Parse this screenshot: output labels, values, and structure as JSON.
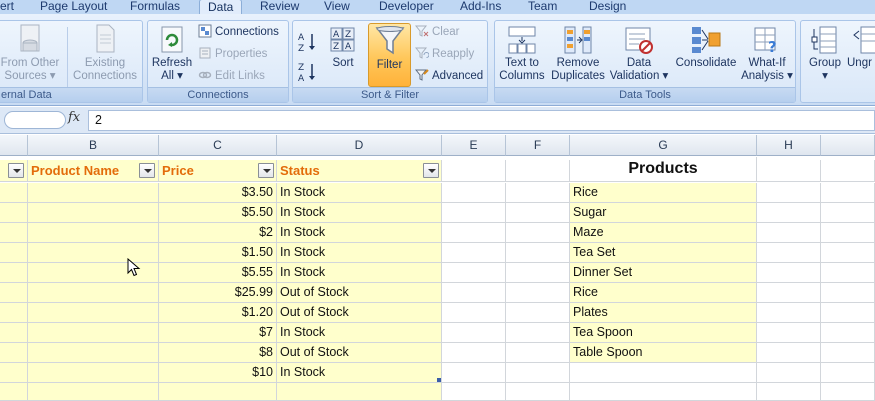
{
  "tabs": [
    "ert",
    "Page Layout",
    "Formulas",
    "Data",
    "Review",
    "View",
    "Developer",
    "Add-Ins",
    "Team",
    "Design"
  ],
  "active_tab": "Data",
  "ribbon": {
    "get_external": {
      "from_other_l1": "From Other",
      "from_other_l2": "Sources",
      "existing_l1": "Existing",
      "existing_l2": "Connections",
      "label": "ernal Data"
    },
    "connections": {
      "refresh_l1": "Refresh",
      "refresh_l2": "All",
      "connections": "Connections",
      "properties": "Properties",
      "edit_links": "Edit Links",
      "label": "Connections"
    },
    "sort_filter": {
      "sort": "Sort",
      "filter": "Filter",
      "clear": "Clear",
      "reapply": "Reapply",
      "advanced": "Advanced",
      "label": "Sort & Filter"
    },
    "data_tools": {
      "text_to_l1": "Text to",
      "text_to_l2": "Columns",
      "remove_l1": "Remove",
      "remove_l2": "Duplicates",
      "validation_l1": "Data",
      "validation_l2": "Validation",
      "consolidate": "Consolidate",
      "whatif_l1": "What-If",
      "whatif_l2": "Analysis",
      "label": "Data Tools"
    },
    "outline": {
      "group": "Group",
      "ungroup": "Ungr"
    }
  },
  "formula_bar": {
    "fx": "fx",
    "value": "2"
  },
  "columns": [
    "B",
    "C",
    "D",
    "E",
    "F",
    "G",
    "H"
  ],
  "table": {
    "headers": [
      "Product Name",
      "Price",
      "Status"
    ],
    "prices": [
      "$3.50",
      "$5.50",
      "$2",
      "$1.50",
      "$5.55",
      "$25.99",
      "$1.20",
      "$7",
      "$8",
      "$10"
    ],
    "statuses": [
      "In Stock",
      "In Stock",
      "In Stock",
      "In Stock",
      "In Stock",
      "Out of Stock",
      "Out of Stock",
      "In Stock",
      "Out of Stock",
      "In Stock"
    ]
  },
  "products": {
    "title": "Products",
    "items": [
      "Rice",
      "Sugar",
      "Maze",
      "Tea Set",
      "Dinner Set",
      "Rice",
      "Plates",
      "Tea Spoon",
      "Table Spoon"
    ]
  },
  "colors": {
    "header_text": "#e36c0a",
    "cell_fill": "#ffffcc",
    "ribbon_bg": "#dbe8f8",
    "filter_active": "#ffc75a"
  }
}
